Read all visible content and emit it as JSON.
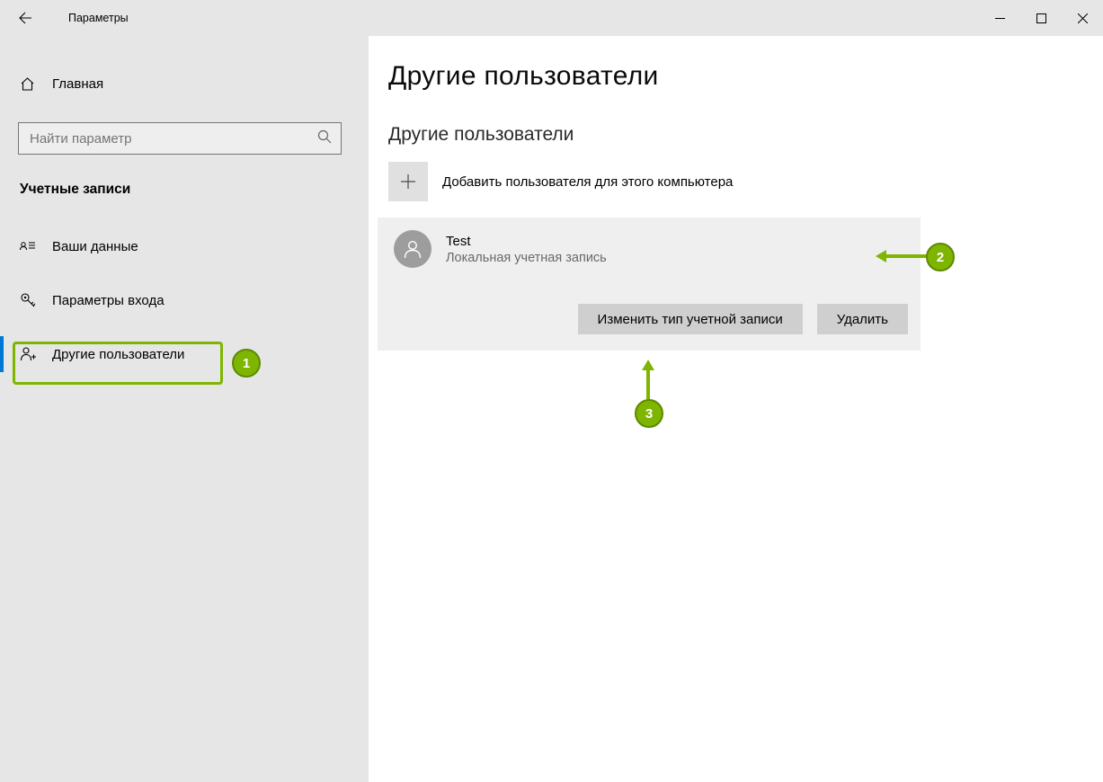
{
  "window": {
    "title": "Параметры"
  },
  "sidebar": {
    "home_label": "Главная",
    "search_placeholder": "Найти параметр",
    "category_label": "Учетные записи",
    "items": [
      {
        "label": "Ваши данные"
      },
      {
        "label": "Параметры входа"
      },
      {
        "label": "Другие пользователи"
      }
    ]
  },
  "page": {
    "title": "Другие пользователи",
    "section_title": "Другие пользователи",
    "add_label": "Добавить пользователя для этого компьютера",
    "user": {
      "name": "Test",
      "type": "Локальная учетная запись"
    },
    "buttons": {
      "change_type": "Изменить тип учетной записи",
      "delete": "Удалить"
    }
  },
  "annotations": {
    "badge1": "1",
    "badge2": "2",
    "badge3": "3"
  },
  "colors": {
    "accent": "#0078d4",
    "annotation": "#7eb500"
  }
}
